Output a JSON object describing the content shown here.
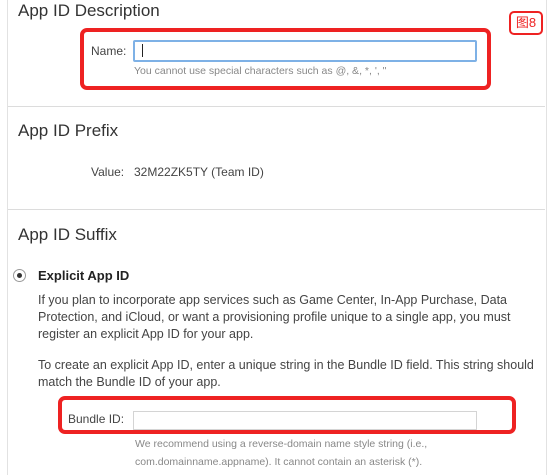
{
  "annotation": {
    "badge": "图8"
  },
  "description_section": {
    "title": "App ID Description",
    "name_label": "Name:",
    "name_value": "",
    "name_hint": "You cannot use special characters such as @, &, *, ', \""
  },
  "prefix_section": {
    "title": "App ID Prefix",
    "value_label": "Value:",
    "value": "32M22ZK5TY (Team ID)"
  },
  "suffix_section": {
    "title": "App ID Suffix",
    "explicit_label": "Explicit App ID",
    "explicit_selected": true,
    "para1": "If you plan to incorporate app services such as Game Center, In-App Purchase, Data Protection, and iCloud, or want a provisioning profile unique to a single app, you must register an explicit App ID for your app.",
    "para2": "To create an explicit App ID, enter a unique string in the Bundle ID field. This string should match the Bundle ID of your app.",
    "bundle_label": "Bundle ID:",
    "bundle_value": "",
    "bundle_hint_line1": "We recommend using a reverse-domain name style string (i.e.,",
    "bundle_hint_line2": "com.domainname.appname). It cannot contain an asterisk (*)."
  },
  "colors": {
    "annotation_red": "#ee2222",
    "input_focus": "#7eb1e6"
  }
}
